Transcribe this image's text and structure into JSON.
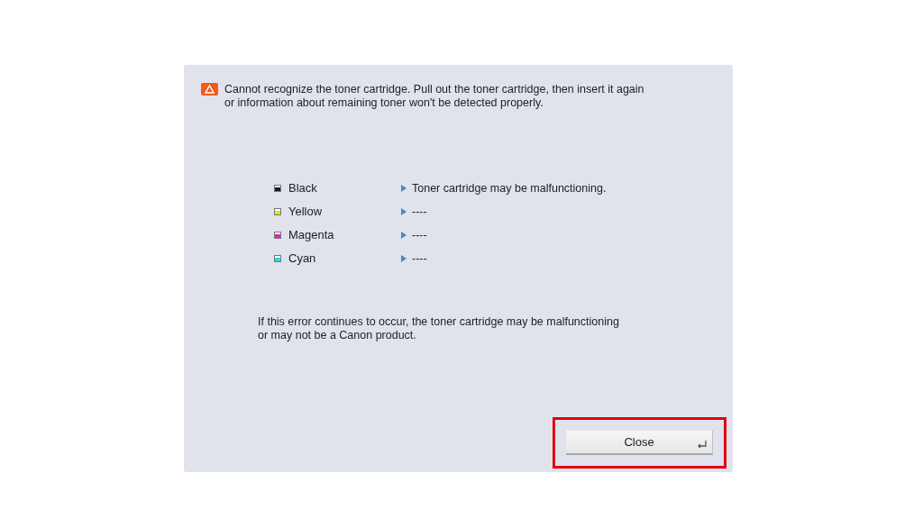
{
  "message": "Cannot recognize the toner cartridge. Pull out the toner cartridge, then insert it again\nor information about remaining toner won't be detected properly.",
  "toners": [
    {
      "name": "Black",
      "color": "#1a1a1a",
      "status": "Toner cartridge may be malfunctioning."
    },
    {
      "name": "Yellow",
      "color": "#e8e800",
      "status": "----"
    },
    {
      "name": "Magenta",
      "color": "#e020d8",
      "status": "----"
    },
    {
      "name": "Cyan",
      "color": "#30d8e0",
      "status": "----"
    }
  ],
  "note": "If this error continues to occur, the toner cartridge may be malfunctioning\nor may not be a Canon product.",
  "close_button": {
    "label": "Close",
    "highlighted": true
  }
}
